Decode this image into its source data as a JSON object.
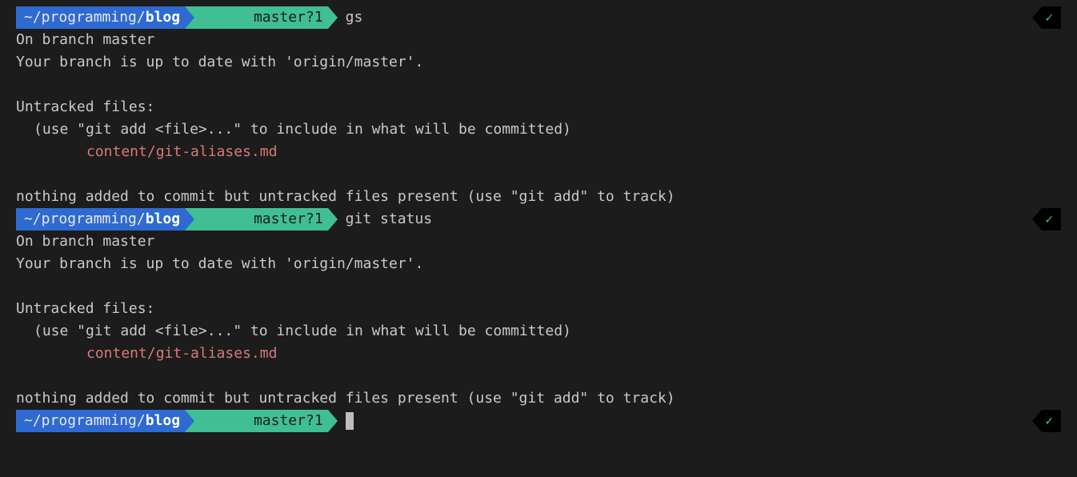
{
  "prompt": {
    "tilde": "~",
    "path_prefix": "/programming/",
    "path_bold": "blog",
    "git_branch": "master",
    "git_status": "?1"
  },
  "status_icon": "✓",
  "cmd1": "gs",
  "cmd2": "git status",
  "out": {
    "on_branch": "On branch master",
    "up_to_date": "Your branch is up to date with 'origin/master'.",
    "untracked_header": "Untracked files:",
    "untracked_hint": "(use \"git add <file>...\" to include in what will be committed)",
    "untracked_file": "content/git-aliases.md",
    "nothing_added": "nothing added to commit but untracked files present (use \"git add\" to track)"
  }
}
